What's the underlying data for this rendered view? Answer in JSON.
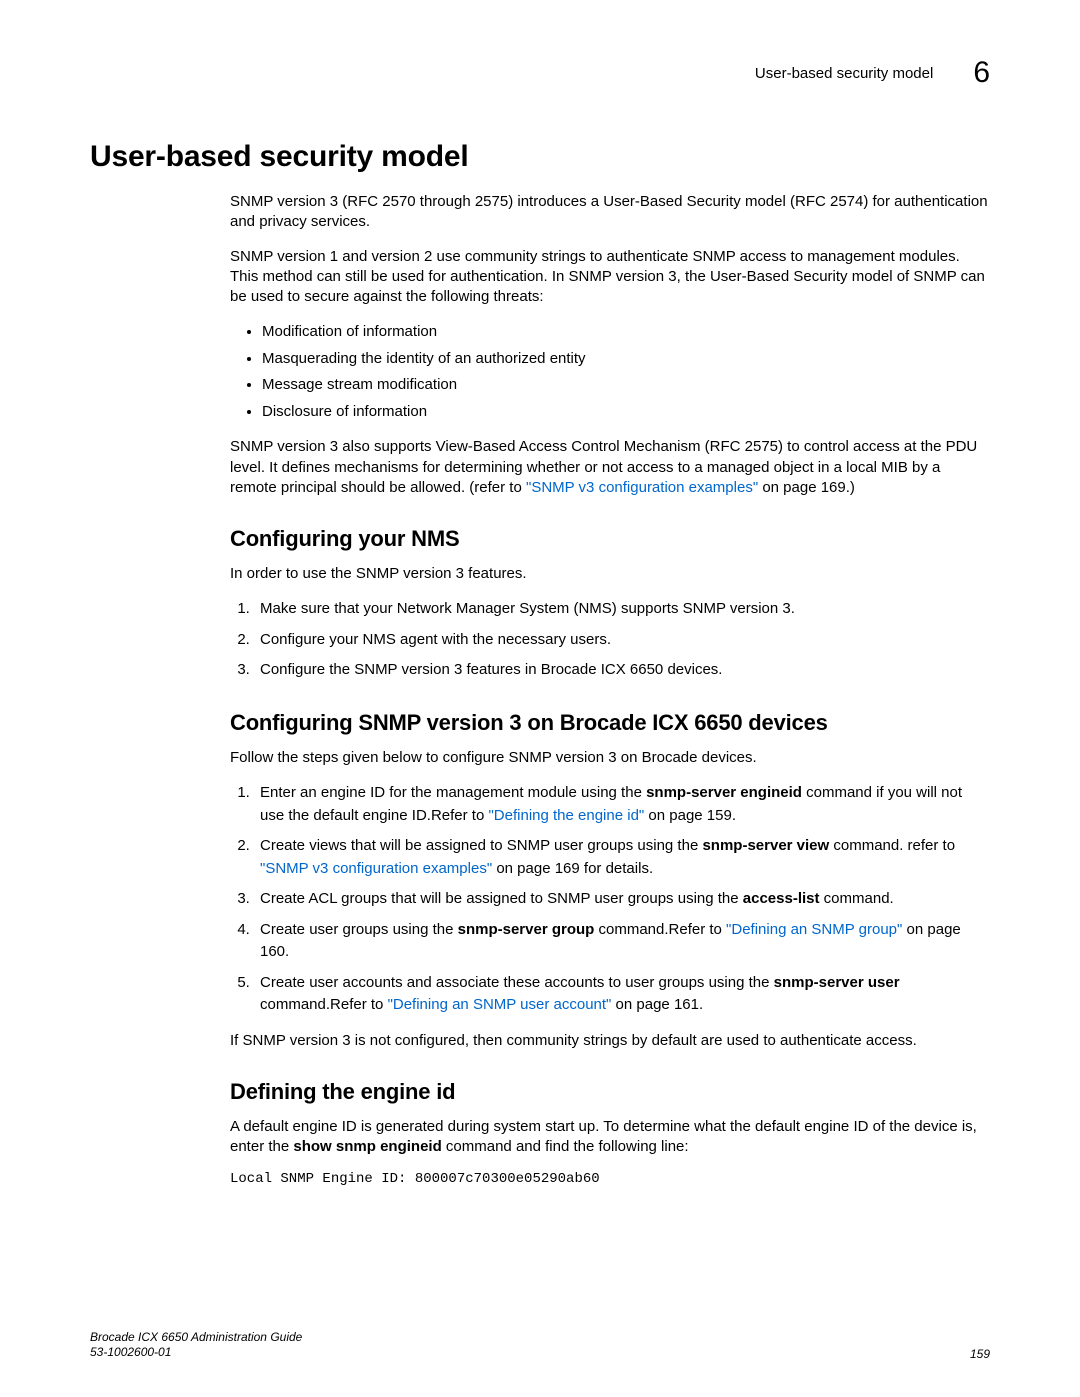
{
  "header": {
    "running_title": "User-based security model",
    "chapter_number": "6"
  },
  "main_heading": "User-based security model",
  "intro": {
    "p1": "SNMP version 3 (RFC 2570 through 2575) introduces a User-Based Security model (RFC 2574) for authentication and privacy services.",
    "p2": "SNMP version 1 and version 2 use community strings to authenticate SNMP access to management modules. This method can still be used for authentication.  In SNMP version 3, the User-Based Security model of SNMP can be used to secure against the following threats:",
    "bullets": [
      "Modification of information",
      "Masquerading the identity of an authorized entity",
      "Message stream modification",
      "Disclosure of information"
    ],
    "p3_a": "SNMP version 3 also supports View-Based Access Control Mechanism (RFC 2575) to control access at the PDU level.  It defines mechanisms for determining whether or not access to a managed object in a local MIB by a remote principal should be allowed. (refer to ",
    "p3_link": "\"SNMP v3 configuration examples\"",
    "p3_b": " on page 169.)"
  },
  "section_nms": {
    "heading": "Configuring your NMS",
    "intro": "In order to use the SNMP version 3 features.",
    "steps": [
      "Make sure that your Network Manager System (NMS) supports SNMP version 3.",
      "Configure your NMS agent with the necessary users.",
      "Configure the SNMP version 3 features in Brocade ICX 6650 devices."
    ]
  },
  "section_snmp3": {
    "heading": "Configuring SNMP version 3 on Brocade ICX 6650 devices",
    "intro": "Follow the steps given below to configure SNMP version 3 on Brocade devices.",
    "step1_a": "Enter an engine ID for the management module using the ",
    "step1_cmd": "snmp-server engineid",
    "step1_b": " command if you will not use the default engine ID.Refer to  ",
    "step1_link": "\"Defining the engine id\"",
    "step1_c": " on page 159.",
    "step2_a": "Create views that will be assigned to SNMP user groups using the ",
    "step2_cmd": "snmp-server view",
    "step2_b": " command. refer to ",
    "step2_link": "\"SNMP v3 configuration examples\"",
    "step2_c": " on page 169 for details.",
    "step3_a": "Create ACL groups that will be assigned to SNMP user groups using the ",
    "step3_cmd": "access-list",
    "step3_b": " command.",
    "step4_a": "Create user groups using the ",
    "step4_cmd": "snmp-server group",
    "step4_b": " command.Refer to ",
    "step4_link": "\"Defining an SNMP group\"",
    "step4_c": " on page 160.",
    "step5_a": "Create user accounts and associate these accounts to user groups using the ",
    "step5_cmd": "snmp-server user",
    "step5_b": " command.Refer to ",
    "step5_link": "\"Defining an SNMP user account\"",
    "step5_c": " on page 161.",
    "outro": "If SNMP version 3 is not configured, then community strings by default are used to authenticate access."
  },
  "section_engine": {
    "heading": "Defining the engine id",
    "p1_a": "A default engine ID is generated during system start up. To determine what the default engine ID of the device is, enter the ",
    "p1_cmd": "show snmp engineid",
    "p1_b": " command and find the following line:",
    "code": "Local SNMP Engine ID: 800007c70300e05290ab60"
  },
  "footer": {
    "title": "Brocade ICX 6650 Administration Guide",
    "docnum": "53-1002600-01",
    "page": "159"
  }
}
